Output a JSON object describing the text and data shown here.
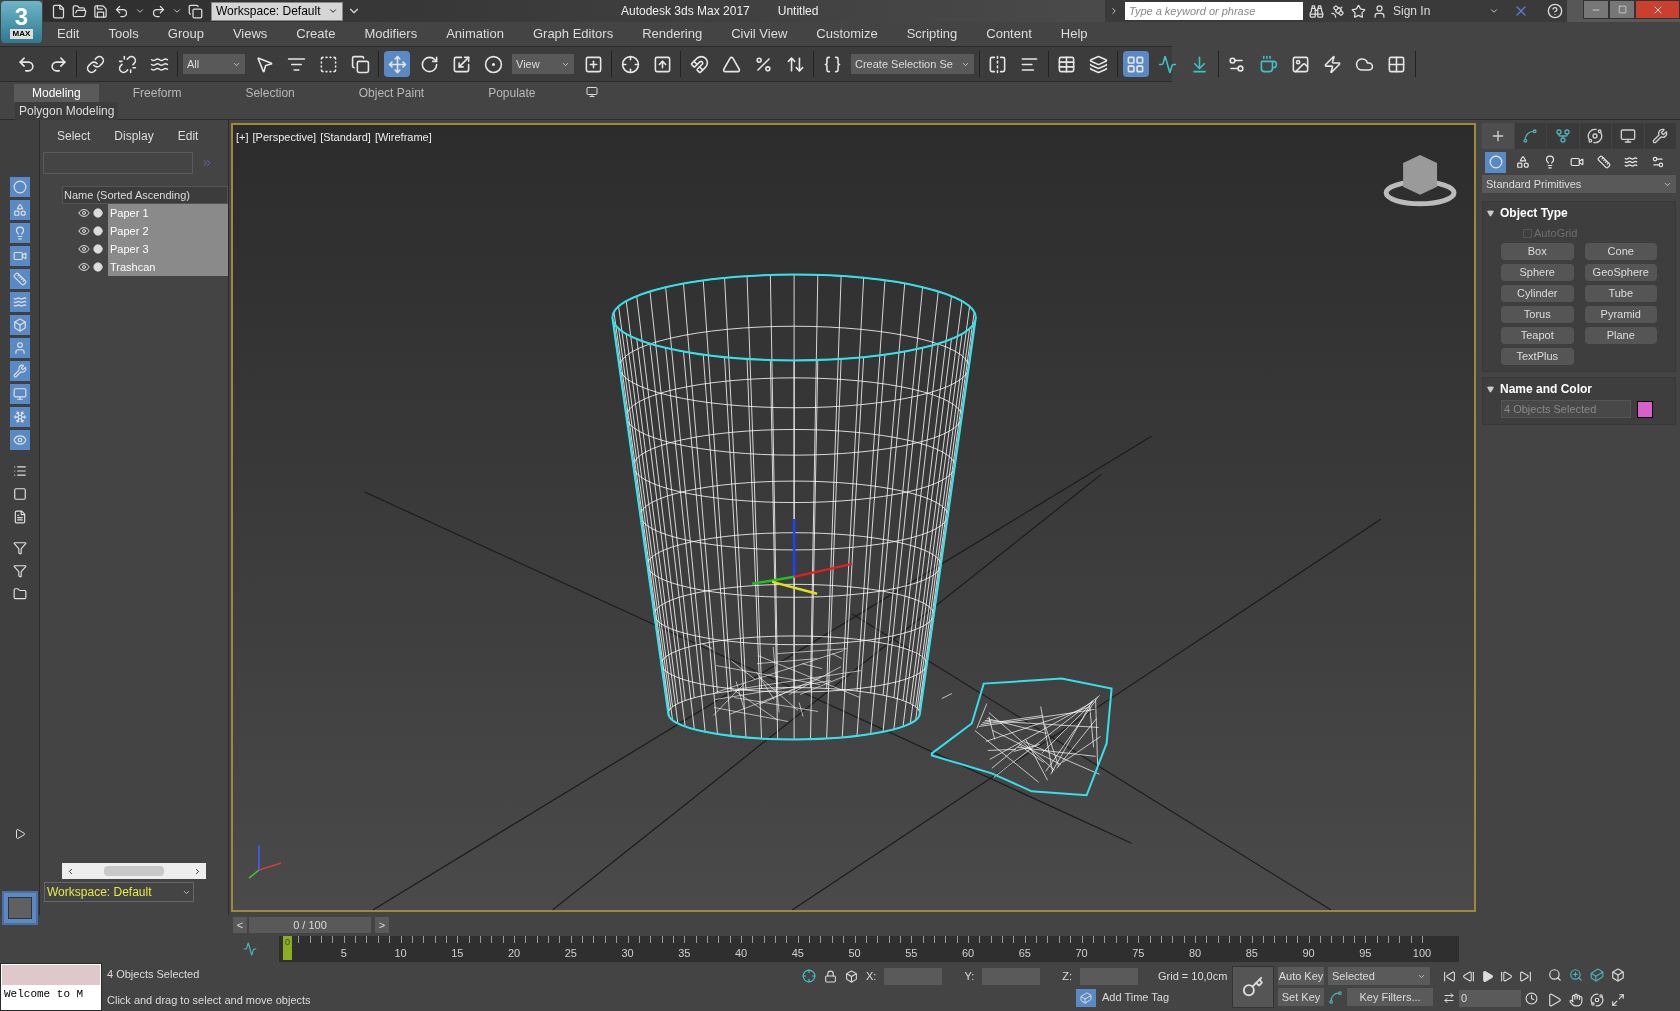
{
  "title_bar": {
    "logo": "3",
    "logo_sub": "MAX",
    "workspace": "Workspace: Default",
    "app_title": "Autodesk 3ds Max 2017",
    "document": "Untitled",
    "search": {
      "placeholder": "Type a keyword or phrase"
    },
    "sign_in": "Sign In"
  },
  "menu": [
    "Edit",
    "Tools",
    "Group",
    "Views",
    "Create",
    "Modifiers",
    "Animation",
    "Graph Editors",
    "Rendering",
    "Civil View",
    "Customize",
    "Scripting",
    "Content",
    "Help"
  ],
  "toolbar": {
    "groups": [
      [
        {
          "kind": "button",
          "selected": false
        },
        {
          "kind": "button",
          "selected": false
        }
      ],
      [
        {
          "kind": "button",
          "selected": false
        },
        {
          "kind": "button",
          "selected": false
        },
        {
          "kind": "button",
          "selected": false
        }
      ],
      [
        {
          "kind": "dropdown",
          "value": "All"
        },
        {
          "kind": "button",
          "selected": false
        },
        {
          "kind": "button",
          "selected": false
        },
        {
          "kind": "button",
          "selected": false
        },
        {
          "kind": "button",
          "selected": false
        }
      ],
      [
        {
          "kind": "button",
          "selected": true
        },
        {
          "kind": "button",
          "selected": false
        },
        {
          "kind": "button",
          "selected": false
        },
        {
          "kind": "button",
          "selected": false
        },
        {
          "kind": "dropdown",
          "value": "View"
        },
        {
          "kind": "button",
          "selected": false
        }
      ],
      [
        {
          "kind": "button",
          "selected": false
        },
        {
          "kind": "button",
          "selected": false
        }
      ],
      [
        {
          "kind": "button",
          "selected": false
        },
        {
          "kind": "button",
          "selected": false
        },
        {
          "kind": "button",
          "selected": false
        },
        {
          "kind": "button",
          "selected": false
        }
      ],
      [
        {
          "kind": "button",
          "selected": false
        },
        {
          "kind": "dropdown",
          "value": "Create Selection Se"
        }
      ],
      [
        {
          "kind": "button",
          "selected": false
        },
        {
          "kind": "button",
          "selected": false
        }
      ],
      [
        {
          "kind": "button",
          "selected": false
        },
        {
          "kind": "button",
          "selected": false
        }
      ],
      [
        {
          "kind": "button",
          "selected": true
        },
        {
          "kind": "button",
          "selected": false
        },
        {
          "kind": "button",
          "selected": false
        }
      ],
      [
        {
          "kind": "button",
          "selected": false
        },
        {
          "kind": "button",
          "selected": false
        },
        {
          "kind": "button",
          "selected": false
        },
        {
          "kind": "button",
          "selected": false
        },
        {
          "kind": "button",
          "selected": false
        },
        {
          "kind": "button",
          "selected": false
        }
      ]
    ]
  },
  "ribbon_tabs": [
    {
      "label": "Modeling",
      "selected": true
    },
    {
      "label": "Freeform",
      "selected": false
    },
    {
      "label": "Selection",
      "selected": false
    },
    {
      "label": "Object Paint",
      "selected": false
    },
    {
      "label": "Populate",
      "selected": false
    }
  ],
  "ribbon_panel": "Polygon Modeling",
  "explorer_filters": [
    {
      "on": true
    },
    {
      "on": true
    },
    {
      "on": true
    },
    {
      "on": true
    },
    {
      "on": true
    },
    {
      "on": true
    },
    {
      "on": true
    },
    {
      "on": true
    },
    {
      "on": true
    },
    {
      "on": true
    },
    {
      "on": true
    },
    {
      "on": true
    },
    {
      "on": false
    },
    {
      "on": false
    },
    {
      "on": false
    },
    {
      "on": false
    },
    {
      "on": false
    },
    {
      "on": false
    }
  ],
  "scene_explorer": {
    "menus": [
      "Select",
      "Display",
      "Edit"
    ],
    "column": "Name (Sorted Ascending)",
    "items": [
      {
        "name": "Paper 1",
        "selected": true
      },
      {
        "name": "Paper 2",
        "selected": true
      },
      {
        "name": "Paper 3",
        "selected": true
      },
      {
        "name": "Trashcan",
        "selected": true
      }
    ],
    "workspace": "Workspace: Default"
  },
  "viewport": {
    "labels": [
      "[+]",
      "[Perspective]",
      "[Standard]",
      "[Wireframe]"
    ]
  },
  "command_panel": {
    "tabs": [
      {
        "selected": true
      },
      {
        "selected": false
      },
      {
        "selected": false
      },
      {
        "selected": false
      },
      {
        "selected": false
      },
      {
        "selected": false
      }
    ],
    "categories": [
      {
        "selected": true
      },
      {
        "selected": false
      },
      {
        "selected": false
      },
      {
        "selected": false
      },
      {
        "selected": false
      },
      {
        "selected": false
      },
      {
        "selected": false
      }
    ],
    "dropdown": "Standard Primitives",
    "object_type": {
      "title": "Object Type",
      "expanded": true,
      "autogrid": {
        "label": "AutoGrid",
        "checked": false
      },
      "buttons": [
        "Box",
        "Cone",
        "Sphere",
        "GeoSphere",
        "Cylinder",
        "Tube",
        "Torus",
        "Pyramid",
        "Teapot",
        "Plane",
        "TextPlus"
      ]
    },
    "name_and_color": {
      "title": "Name and Color",
      "expanded": true,
      "placeholder": "4 Objects Selected",
      "color": "#d95fcb"
    }
  },
  "time_slider": {
    "prev": "<",
    "frame": "0 / 100",
    "next": ">"
  },
  "timeline": {
    "marker": "0",
    "labels": [
      "5",
      "10",
      "15",
      "20",
      "25",
      "30",
      "35",
      "40",
      "45",
      "50",
      "55",
      "60",
      "65",
      "70",
      "75",
      "80",
      "85",
      "90",
      "95",
      "100"
    ]
  },
  "status": {
    "listener": "Welcome to M",
    "selection": "4 Objects Selected",
    "prompt": "Click and drag to select and move objects",
    "x_label": "X:",
    "y_label": "Y:",
    "z_label": "Z:",
    "grid": "Grid = 10,0cm",
    "add_time_tag": "Add Time Tag",
    "auto_key": "Auto Key",
    "set_key": "Set Key",
    "key_mode": "Selected",
    "key_filters": "Key Filters...",
    "frame": "0"
  }
}
